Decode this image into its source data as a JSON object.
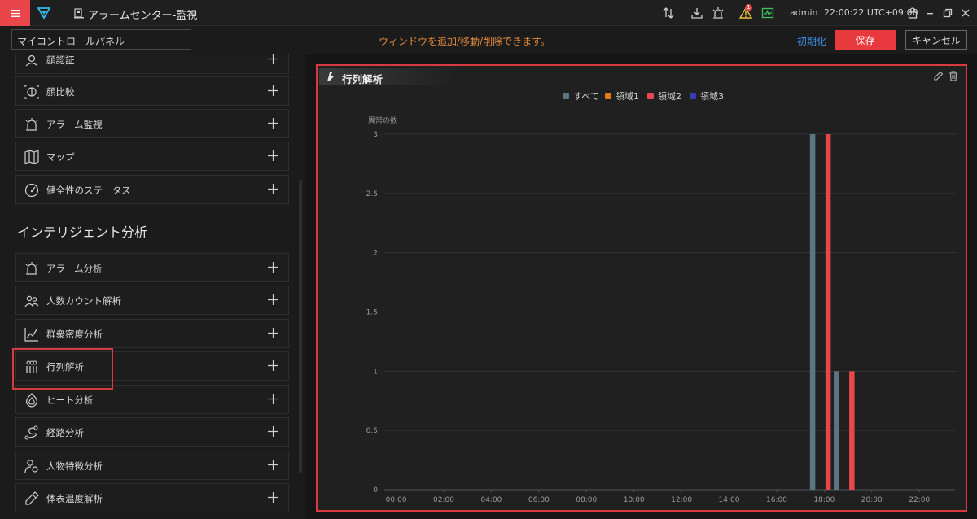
{
  "titlebar": {
    "app_title": "アラームセンター-監視",
    "user": "admin",
    "clock": "22:00:22 UTC+09:00",
    "alarm_count": "1"
  },
  "toolbar": {
    "panel_name": "マイコントロールパネル",
    "message": "ウィンドウを追加/移動/削除できます。",
    "reset_label": "初期化",
    "save_label": "保存",
    "cancel_label": "キャンセル"
  },
  "sidebar": {
    "items_top": [
      {
        "label": "顔認証",
        "icon": "face-recognition-icon"
      },
      {
        "label": "顔比較",
        "icon": "face-compare-icon"
      },
      {
        "label": "アラーム監視",
        "icon": "alarm-icon"
      },
      {
        "label": "マップ",
        "icon": "map-icon"
      },
      {
        "label": "健全性のステータス",
        "icon": "gauge-icon"
      }
    ],
    "section_title": "インテリジェント分析",
    "items_analysis": [
      {
        "label": "アラーム分析",
        "icon": "alarm-icon"
      },
      {
        "label": "人数カウント解析",
        "icon": "people-count-icon"
      },
      {
        "label": "群衆密度分析",
        "icon": "crowd-density-icon"
      },
      {
        "label": "行列解析",
        "icon": "queue-icon"
      },
      {
        "label": "ヒート分析",
        "icon": "heatmap-icon"
      },
      {
        "label": "経路分析",
        "icon": "path-icon"
      },
      {
        "label": "人物特徴分析",
        "icon": "person-feature-icon"
      },
      {
        "label": "体表温度解析",
        "icon": "thermometer-icon"
      }
    ]
  },
  "panel": {
    "title": "行列解析"
  },
  "colors": {
    "accent": "#e8393e",
    "series_all": "#5d7482",
    "series_area1": "#e07a1f",
    "series_area2": "#e8464a",
    "series_area3": "#3a38b8"
  },
  "chart_data": {
    "type": "bar",
    "ylabel": "異常の数",
    "ylim": [
      0,
      3
    ],
    "yticks": [
      "0",
      "0.5",
      "1",
      "1.5",
      "2",
      "2.5",
      "3"
    ],
    "xticks": [
      "00:00",
      "02:00",
      "04:00",
      "06:00",
      "08:00",
      "10:00",
      "12:00",
      "14:00",
      "16:00",
      "18:00",
      "20:00",
      "22:00"
    ],
    "categories": [
      "00:00",
      "01:00",
      "02:00",
      "03:00",
      "04:00",
      "05:00",
      "06:00",
      "07:00",
      "08:00",
      "09:00",
      "10:00",
      "11:00",
      "12:00",
      "13:00",
      "14:00",
      "15:00",
      "16:00",
      "17:00",
      "18:00",
      "19:00",
      "20:00",
      "21:00",
      "22:00",
      "23:00"
    ],
    "legend_position": "top-center",
    "grid": true,
    "series": [
      {
        "name": "すべて",
        "color": "#5d7482",
        "values": [
          0,
          0,
          0,
          0,
          0,
          0,
          0,
          0,
          0,
          0,
          0,
          0,
          0,
          0,
          0,
          0,
          0,
          0,
          3,
          1,
          0,
          0,
          0,
          0
        ]
      },
      {
        "name": "領域1",
        "color": "#e07a1f",
        "values": [
          0,
          0,
          0,
          0,
          0,
          0,
          0,
          0,
          0,
          0,
          0,
          0,
          0,
          0,
          0,
          0,
          0,
          0,
          0,
          0,
          0,
          0,
          0,
          0
        ]
      },
      {
        "name": "領域2",
        "color": "#e8464a",
        "values": [
          0,
          0,
          0,
          0,
          0,
          0,
          0,
          0,
          0,
          0,
          0,
          0,
          0,
          0,
          0,
          0,
          0,
          0,
          3,
          1,
          0,
          0,
          0,
          0
        ]
      },
      {
        "name": "領域3",
        "color": "#3a38b8",
        "values": [
          0,
          0,
          0,
          0,
          0,
          0,
          0,
          0,
          0,
          0,
          0,
          0,
          0,
          0,
          0,
          0,
          0,
          0,
          0,
          0,
          0,
          0,
          0,
          0
        ]
      }
    ]
  }
}
